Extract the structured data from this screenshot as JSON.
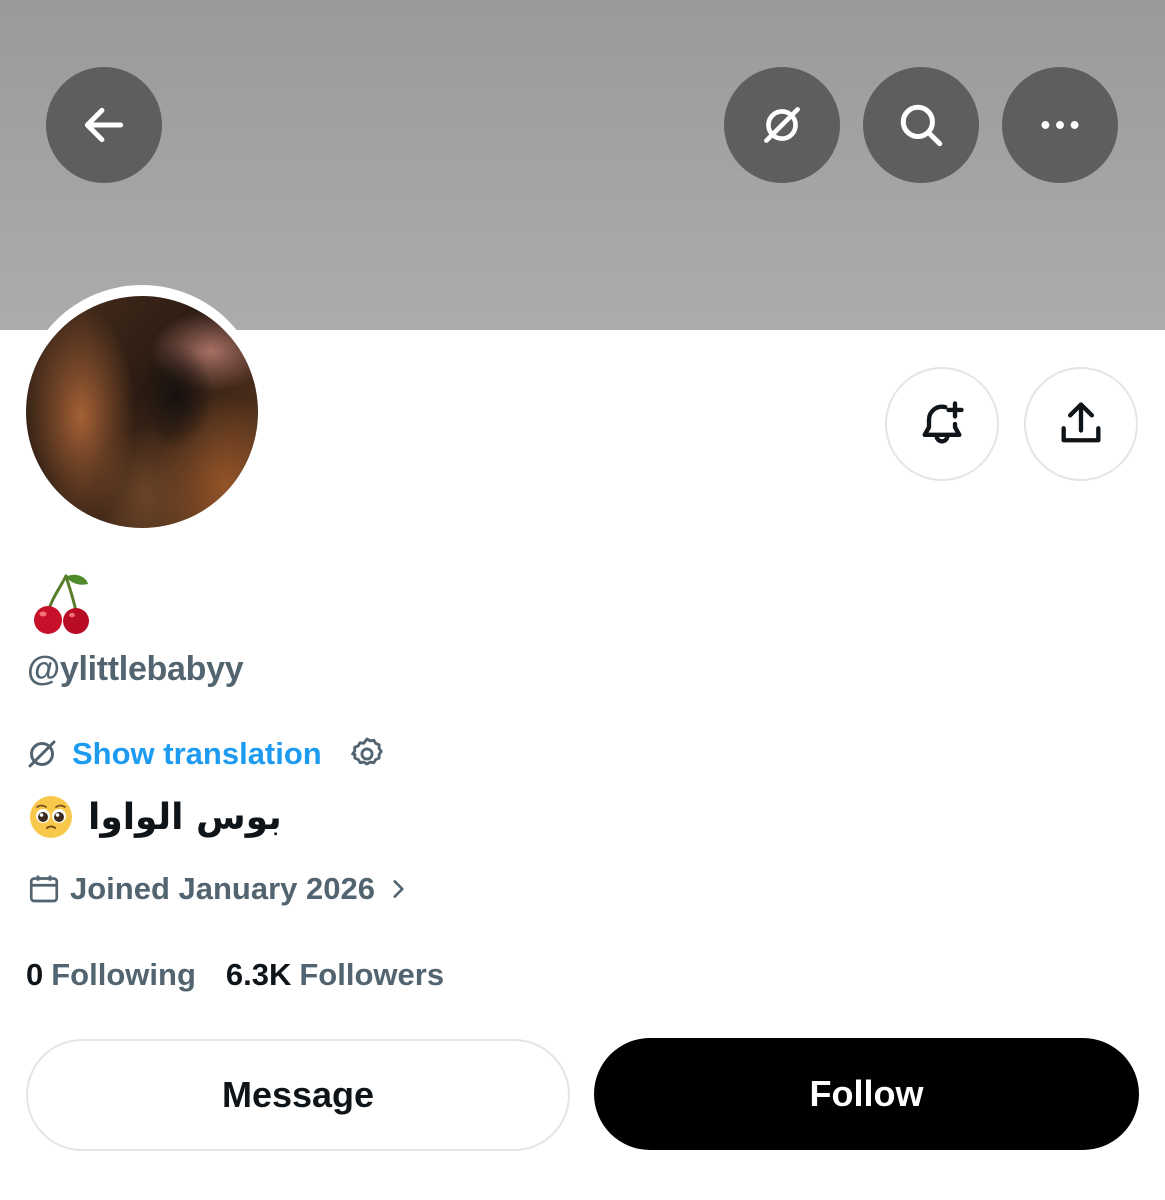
{
  "header": {
    "back_icon": "arrow-left-icon",
    "translate_icon": "translate-off-icon",
    "search_icon": "search-icon",
    "more_icon": "more-horizontal-icon"
  },
  "profile": {
    "name_emoji": "🍒",
    "handle": "@ylittlebabyy",
    "show_translation": "Show translation",
    "bio": "بوس الواوا",
    "bio_emoji": "🥺",
    "joined": "Joined January 2026",
    "following_count": "0",
    "following_label": "Following",
    "followers_count": "6.3K",
    "followers_label": "Followers"
  },
  "actions": {
    "bell_icon": "bell-plus-icon",
    "share_icon": "share-upload-icon",
    "message_label": "Message",
    "follow_label": "Follow"
  },
  "colors": {
    "accent": "#1d9bf0",
    "secondary_text": "#536471",
    "primary_text": "#0f1419",
    "banner": "#a3a3a3"
  }
}
